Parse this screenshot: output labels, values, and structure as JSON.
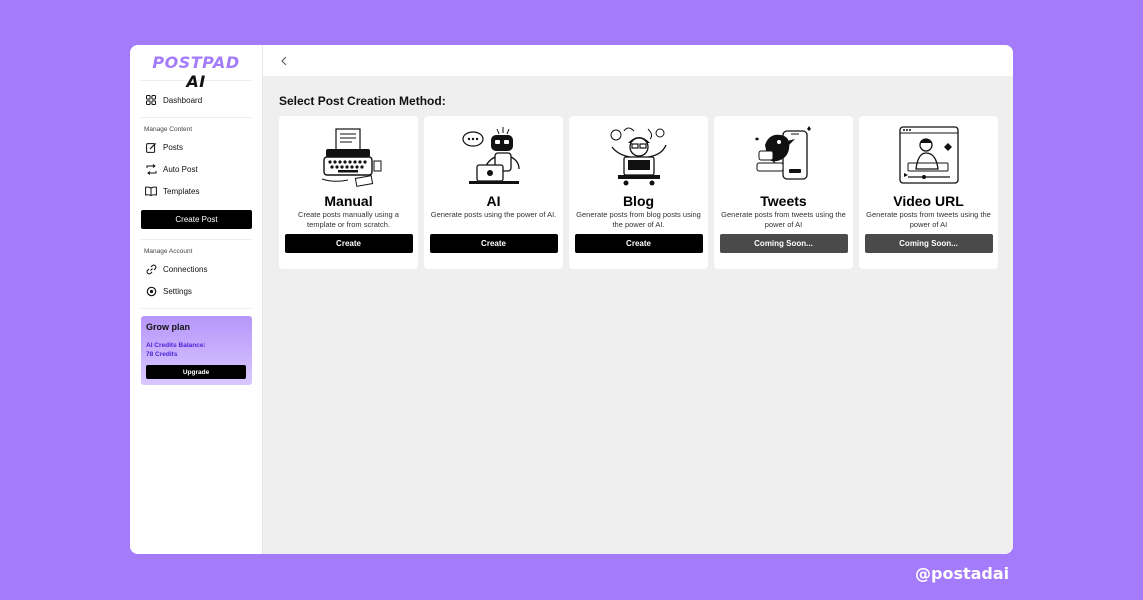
{
  "brand": {
    "name": "POSTPAD",
    "suffix": "AI",
    "accent": "#a47cfb"
  },
  "sidebar": {
    "dashboard": {
      "label": "Dashboard",
      "icon": "grid-icon"
    },
    "manage_content_label": "Manage Content",
    "content_items": [
      {
        "label": "Posts",
        "icon": "edit-icon"
      },
      {
        "label": "Auto Post",
        "icon": "repeat-icon"
      },
      {
        "label": "Templates",
        "icon": "book-icon"
      }
    ],
    "create_post_label": "Create Post",
    "manage_account_label": "Manage Account",
    "account_items": [
      {
        "label": "Connections",
        "icon": "link-icon"
      },
      {
        "label": "Settings",
        "icon": "gear-icon"
      }
    ],
    "plan": {
      "title": "Grow plan",
      "credits_label": "AI Credits Balance:",
      "credits_value": "78 Credits",
      "upgrade_label": "Upgrade"
    }
  },
  "main": {
    "title": "Select Post Creation Method:",
    "cards": [
      {
        "title": "Manual",
        "description": "Create posts manually using a template or from scratch.",
        "button": "Create",
        "illustration": "typewriter-icon"
      },
      {
        "title": "AI",
        "description": "Generate posts using the power of AI.",
        "button": "Create",
        "illustration": "robot-icon"
      },
      {
        "title": "Blog",
        "description": "Generate posts from blog posts using the power of AI.",
        "button": "Create",
        "illustration": "blogger-icon"
      },
      {
        "title": "Tweets",
        "description": "Generate posts from tweets using the power of AI",
        "button": "Coming Soon...",
        "illustration": "bird-phone-icon"
      },
      {
        "title": "Video URL",
        "description": "Generate posts from tweets using the power of AI",
        "button": "Coming Soon...",
        "illustration": "video-player-icon"
      }
    ]
  },
  "footer": {
    "handle": "@postadai"
  }
}
